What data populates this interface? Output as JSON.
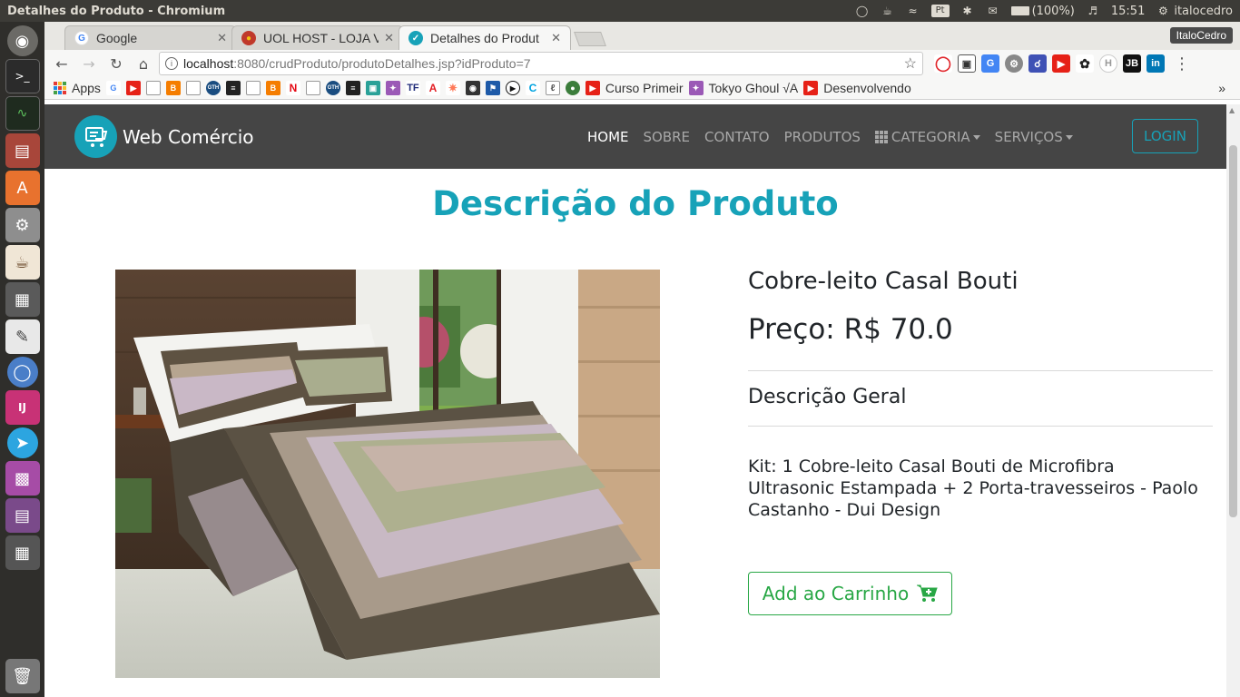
{
  "panel": {
    "window_title": "Detalhes do Produto - Chromium",
    "battery": "(100%)",
    "time": "15:51",
    "user": "italocedro"
  },
  "browser": {
    "tabs": [
      {
        "label": "Google",
        "icon": "google-favicon"
      },
      {
        "label": "UOL HOST - LOJA V",
        "icon": "uol-favicon"
      },
      {
        "label": "Detalhes do Produt",
        "icon": "webcomercio-favicon",
        "active": true
      }
    ],
    "profile": "ItaloCedro",
    "url_host": "localhost",
    "url_path": ":8080/crudProduto/produtoDetalhes.jsp?idProduto=7",
    "bookmarks": {
      "apps": "Apps",
      "curso": "Curso Primeir",
      "tokyo": "Tokyo Ghoul √A",
      "desenvolvendo": "Desenvolvendo",
      "more": "»"
    }
  },
  "site": {
    "brand": "Web Comércio",
    "nav": {
      "home": "HOME",
      "sobre": "SOBRE",
      "contato": "CONTATO",
      "produtos": "PRODUTOS",
      "categoria": "CATEGORIA",
      "servicos": "SERVIÇOS"
    },
    "login": "LOGIN"
  },
  "main": {
    "page_title": "Descrição do Produto",
    "product_name": "Cobre-leito Casal Bouti",
    "price": "Preço: R$ 70.0",
    "description_title": "Descrição Geral",
    "description": "Kit: 1 Cobre-leito Casal Bouti de Microfibra Ultrasonic Estampada + 2 Porta-travesseiros - Paolo Castanho - Dui Design",
    "cart_button": "Add ao Carrinho"
  },
  "colors": {
    "accent": "#17a2b8",
    "success": "#28a745",
    "navbar": "#454545"
  }
}
